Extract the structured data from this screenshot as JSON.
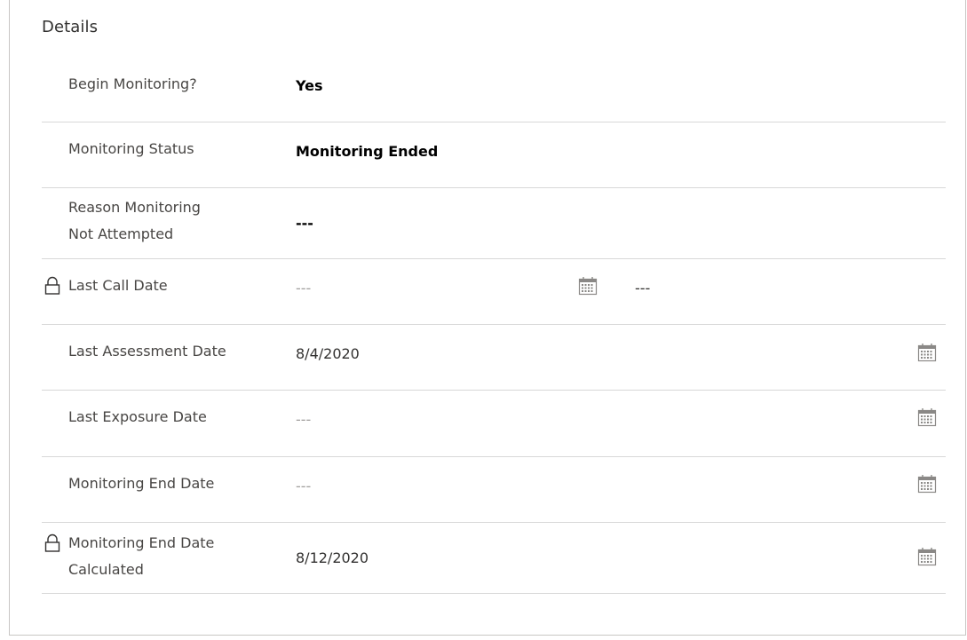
{
  "section": {
    "title": "Details"
  },
  "fields": {
    "begin_monitoring": {
      "label": "Begin Monitoring?",
      "value": "Yes"
    },
    "monitoring_status": {
      "label": "Monitoring Status",
      "value": "Monitoring Ended"
    },
    "reason_not_attempted": {
      "label_line1": "Reason Monitoring",
      "label_line2": "Not Attempted",
      "value": "---"
    },
    "last_call_date": {
      "label": "Last Call Date",
      "date_value": "---",
      "time_value": "---"
    },
    "last_assessment_date": {
      "label": "Last Assessment Date",
      "value": "8/4/2020"
    },
    "last_exposure_date": {
      "label": "Last Exposure Date",
      "value": "---"
    },
    "monitoring_end_date": {
      "label": "Monitoring End Date",
      "value": "---"
    },
    "monitoring_end_date_calculated": {
      "label_line1": "Monitoring End Date",
      "label_line2": "Calculated",
      "value": "8/12/2020"
    }
  },
  "icons": {
    "lock": "lock-icon",
    "calendar": "calendar-icon"
  },
  "colors": {
    "border": "#c8c6c4",
    "divider": "#d8d8d8",
    "icon": "#8a8886",
    "placeholder": "#a19f9d"
  }
}
